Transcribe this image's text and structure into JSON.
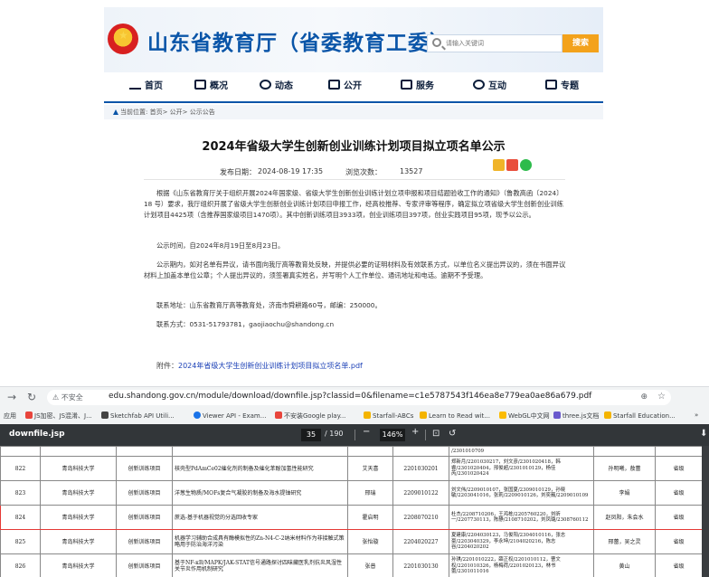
{
  "site": {
    "title": "山东省教育厅（省委教育工委）",
    "search_placeholder": "请输入关键词",
    "search_button": "搜索",
    "nav": [
      "首页",
      "概况",
      "动态",
      "公开",
      "服务",
      "互动",
      "专题"
    ],
    "breadcrumb": "当前位置: 首页> 公开> 公示公告"
  },
  "article": {
    "title": "2024年省级大学生创新创业训练计划项目拟立项名单公示",
    "publish_label": "发布日期：",
    "publish_date": "2024-08-19 17:35",
    "views_label": "浏览次数：",
    "views": "13527",
    "paragraphs": [
      "根据《山东省教育厅关于组织开展2024年国家级、省级大学生创新创业训练计划立项申报和项目结题验收工作的通知》（鲁教高函〔2024〕18 号）要求，我厅组织开展了省级大学生创新创业训练计划项目申报工作，经高校推荐、专家评审等程序，确定拟立项省级大学生创新创业训练计划项目4425项（含推荐国家级项目1470项）。其中创新训练项目3933项，创业训练项目397项，创业实践项目95项，现予以公示。",
      "公示时间，自2024年8月19日至8月23日。",
      "公示期内，如对名单有异议，请书面向我厅高等教育处反映，并提供必要的证明材料及有效联系方式，以单位名义提出异议的，须在书面异议材料上加盖本单位公章；个人提出异议的，须签署真实姓名，并写明个人工作单位、通讯地址和电话。逾期不予受理。",
      "联系地址：山东省教育厅高等教育处，济南市舜耕路60号，邮编：250000。",
      "联系方式：0531-51793781，gaojiaochu@shandong.cn"
    ],
    "attachment_label": "附件：",
    "attachment_link": "2024年省级大学生创新创业训练计划项目拟立项名单.pdf"
  },
  "browser": {
    "security_label": "不安全",
    "url": "edu.shandong.gov.cn/module/download/downfile.jsp?classid=0&filename=c1e5787543f146ea8e779ea0ae86a679.pdf",
    "bookmarks": [
      "应用",
      "JS加密、JS混淆、J...",
      "Sketchfab API Utili...",
      "Viewer API - Exam...",
      "不安装Google play...",
      "Starfall-ABCs",
      "Learn to Read wit...",
      "WebGL中文网",
      "three.js文档",
      "Starfall Education..."
    ]
  },
  "pdf": {
    "filename": "downfile.jsp",
    "page_current": "35",
    "page_total": "/ 190",
    "zoom": "146%",
    "rows": [
      {
        "no": "",
        "school": "",
        "type": "",
        "name": "",
        "leader": "",
        "id": "",
        "members": "/2301010709",
        "advisor": "",
        "level": "",
        "highlight": false
      },
      {
        "no": "822",
        "school": "青岛科技大学",
        "type": "创新训练项目",
        "name": "核壳型PdAmCe02催化剂的制备及催化苯酚加氢性能研究",
        "leader": "艾天喜",
        "id": "2201030201",
        "members": "郑新月/2201030217，刘文彦/2301020418，韩睿/2301020404，邢俊超/2301010129，杨佳芮/2301020424",
        "advisor": "孙明曦，敖蕾",
        "level": "省级",
        "highlight": false
      },
      {
        "no": "823",
        "school": "青岛科技大学",
        "type": "创新训练项目",
        "name": "洋葱生物质/MOFs复合气凝胶的制备及海水提铀研究",
        "leader": "邢瑞",
        "id": "2209010122",
        "members": "刘文伟/2209010107，张国夏/2309010129，孙晓敏/2203041016，张莉/2209010126，刘奕巍/2209010109",
        "advisor": "李娟",
        "level": "省级",
        "highlight": false
      },
      {
        "no": "824",
        "school": "青岛科技大学",
        "type": "创新训练项目",
        "name": "蔗选-基于机器视觉的分选回收专家",
        "leader": "霍启明",
        "id": "2208070210",
        "members": "杜杰/2208710206，王鸿栋/2205760220，刘昕一/2207730113，陈静/2108710202，刘凤璐/2308760112",
        "advisor": "赵凤阳，朱会水",
        "level": "省级",
        "highlight": true
      },
      {
        "no": "825",
        "school": "青岛科技大学",
        "type": "创新训练项目",
        "name": "机器学习辅助合成具有酶模拟性的Zn-N4-C-2纳米材料作为非接触式策略用于防治海洋污染",
        "leader": "张怡璇",
        "id": "2204020227",
        "members": "夏建康/2204030123，马俊阳/2304010116，张志豪/2203040329，李永坤/2104020216，陈志谷/2204020202",
        "advisor": "邢蕾，吴之灵",
        "level": "省级",
        "highlight": false
      },
      {
        "no": "826",
        "school": "青岛科技大学",
        "type": "创新训练项目",
        "name": "基于NF-κB/MAPK/JAK-STAT信号通路探讨四味藏医乳剂抗炎风湿性关节炎作用机制研究",
        "leader": "张普",
        "id": "2201030130",
        "members": "孙琪/2201010222，薛正权/2201010112，曹文权/2201010326，杨梅荷/2201020123，林书蕾/2301011016",
        "advisor": "黄山",
        "level": "省级",
        "highlight": false
      }
    ]
  }
}
